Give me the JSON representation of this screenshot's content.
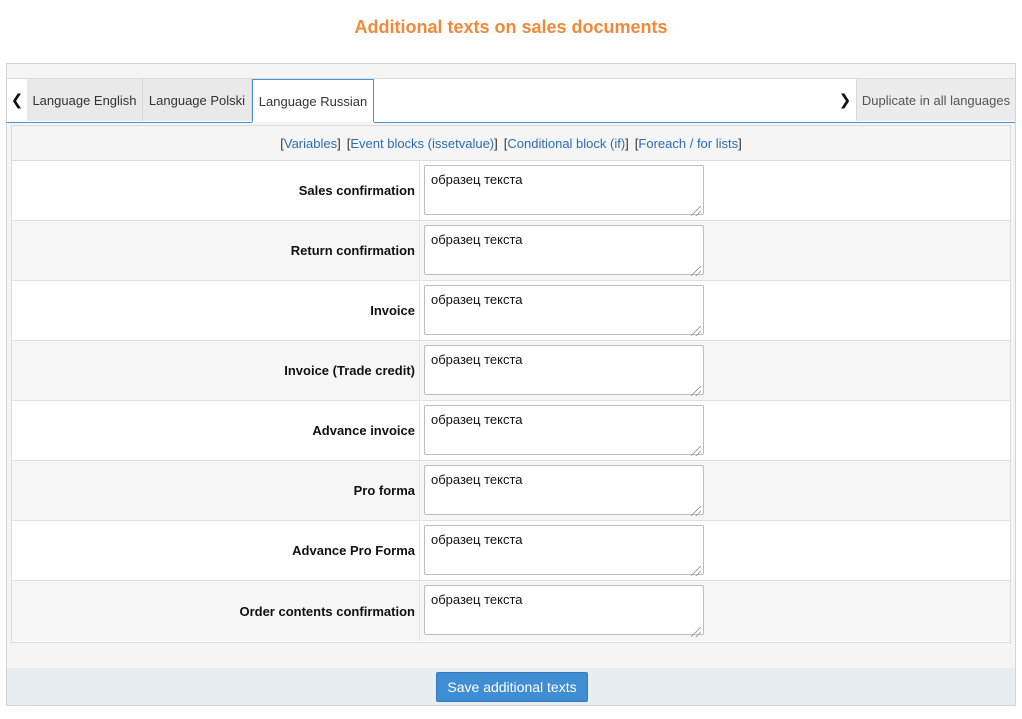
{
  "page_title": "Additional texts on sales documents",
  "tabs": {
    "prev_icon": "chevron-left-icon",
    "next_icon": "chevron-right-icon",
    "items": [
      {
        "label": "Language English",
        "active": false
      },
      {
        "label": "Language Polski",
        "active": false
      },
      {
        "label": "Language Russian",
        "active": true
      }
    ],
    "duplicate_label": "Duplicate in all languages"
  },
  "help_links": {
    "variables": "Variables",
    "event_blocks": "Event blocks (issetvalue)",
    "conditional_block": "Conditional block (if)",
    "foreach": "Foreach / for lists"
  },
  "fields": [
    {
      "label": "Sales confirmation",
      "value": "образец текста"
    },
    {
      "label": "Return confirmation",
      "value": "образец текста"
    },
    {
      "label": "Invoice",
      "value": "образец текста"
    },
    {
      "label": "Invoice (Trade credit)",
      "value": "образец текста"
    },
    {
      "label": "Advance invoice",
      "value": "образец текста"
    },
    {
      "label": "Pro forma",
      "value": "образец текста"
    },
    {
      "label": "Advance Pro Forma",
      "value": "образец текста"
    },
    {
      "label": "Order contents confirmation",
      "value": "образец текста"
    }
  ],
  "save_label": "Save additional texts",
  "colors": {
    "title": "#f08a3a",
    "accent": "#4a93d6",
    "link": "#2a6db3",
    "save_button": "#3f8dd3"
  }
}
